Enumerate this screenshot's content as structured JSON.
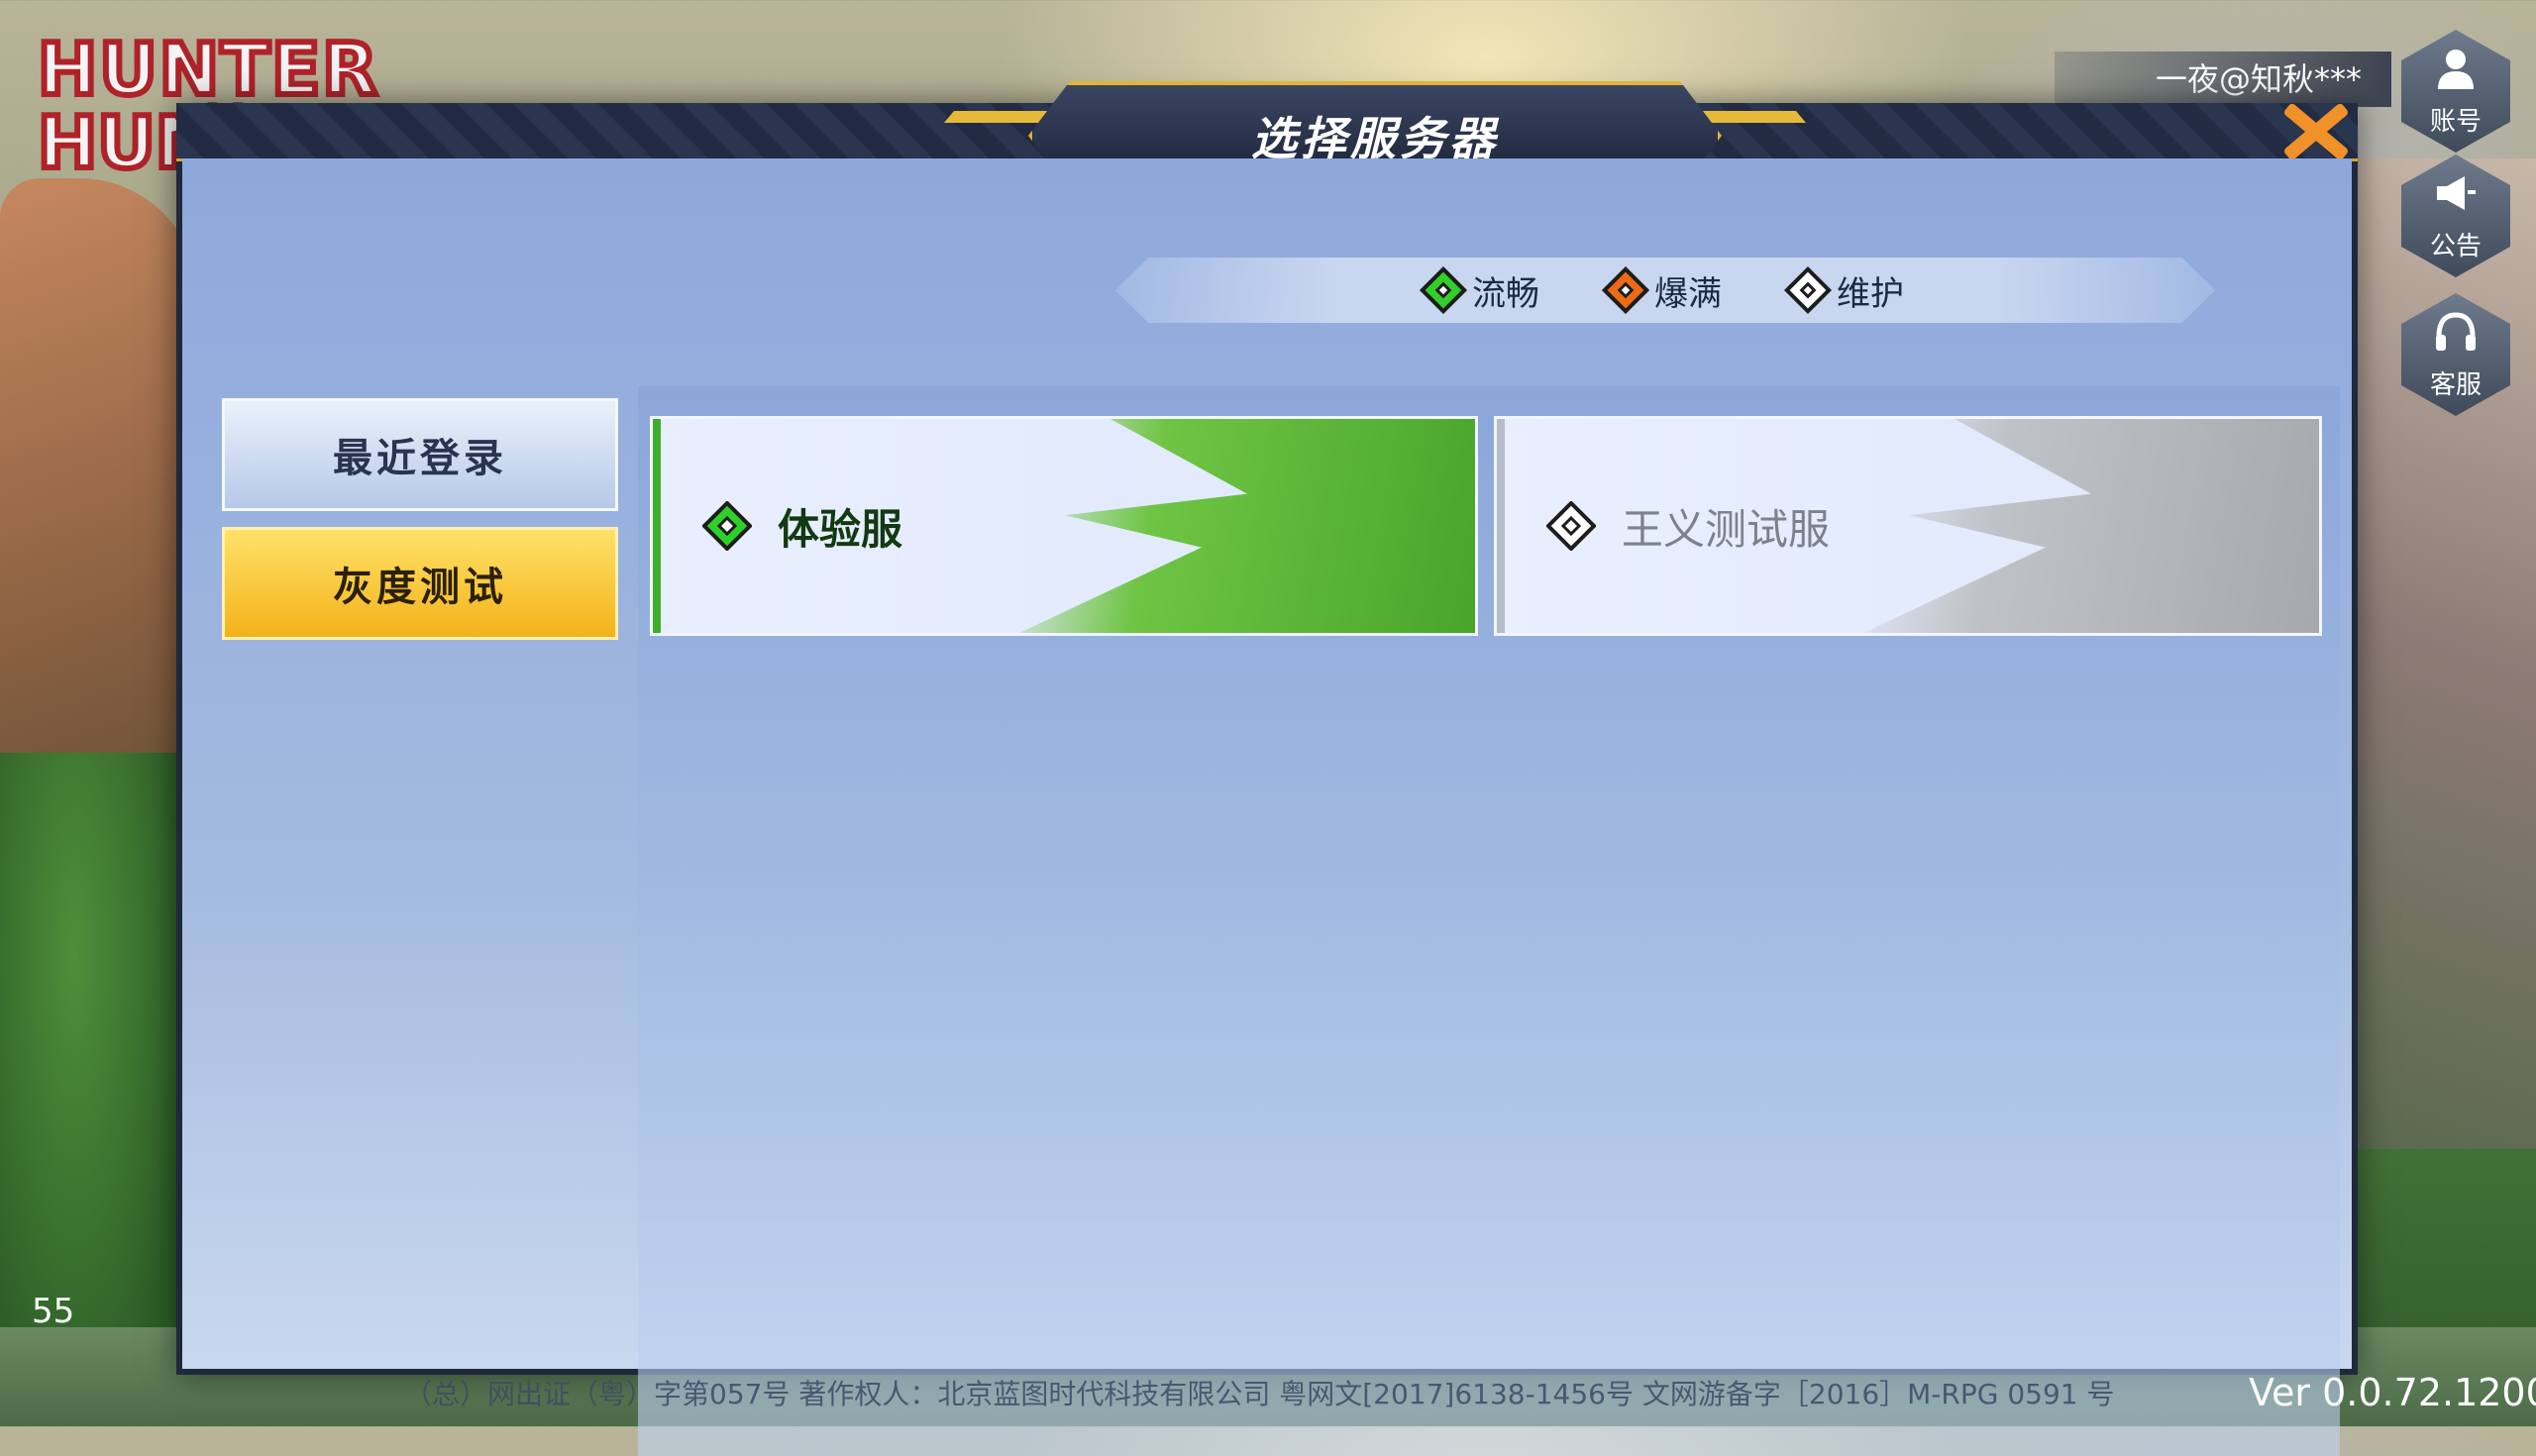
{
  "logo": {
    "line1": "HUNTER",
    "line2": "HUN",
    "mark": "X"
  },
  "account": {
    "name": "一夜@知秋***"
  },
  "side_buttons": [
    {
      "label": "账号",
      "icon": "person-icon"
    },
    {
      "label": "公告",
      "icon": "megaphone-icon"
    },
    {
      "label": "客服",
      "icon": "headset-icon"
    }
  ],
  "fps": "55",
  "dialog": {
    "title": "选择服务器",
    "close_icon": "close-icon"
  },
  "legend": [
    {
      "label": "流畅",
      "color": "#2fd02a"
    },
    {
      "label": "爆满",
      "color": "#f06a12"
    },
    {
      "label": "维护",
      "color": "#ffffff"
    }
  ],
  "tabs": [
    {
      "label": "最近登录",
      "selected": false
    },
    {
      "label": "灰度测试",
      "selected": true
    }
  ],
  "servers": [
    {
      "name": "体验服",
      "status": "流畅",
      "status_color": "#2fd02a"
    },
    {
      "name": "王义测试服",
      "status": "维护",
      "status_color": "#ffffff"
    }
  ],
  "footer": {
    "copyright": "（总）网出证（粤）字第057号  著作权人：北京蓝图时代科技有限公司  粤网文[2017]6138-1456号  文网游备字［2016］M-RPG 0591 号",
    "version": "Ver 0.0.72.1200"
  }
}
